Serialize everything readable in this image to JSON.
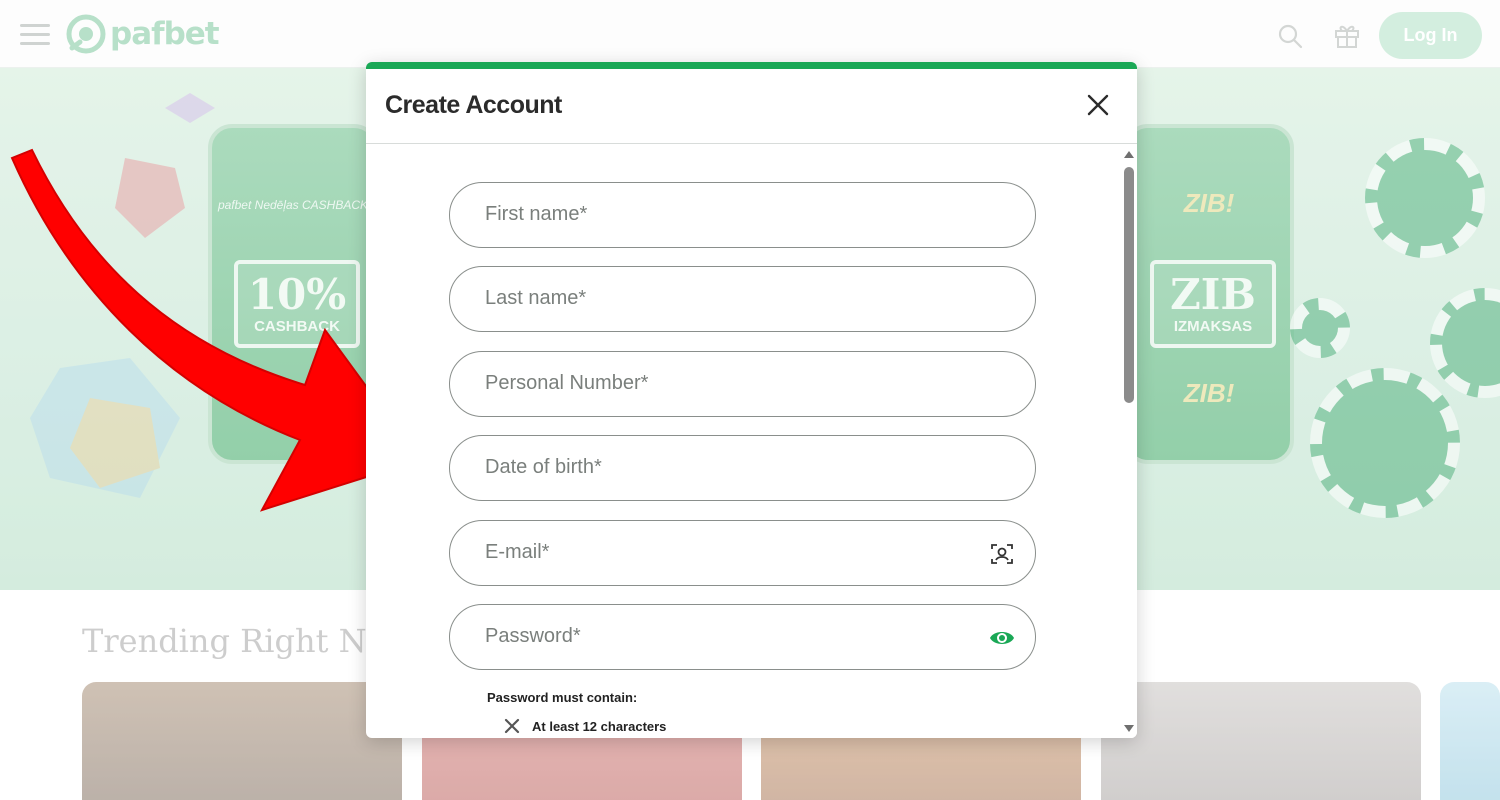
{
  "site": {
    "brand": "pafbet",
    "login_label": "Log In"
  },
  "hero": {
    "left_phone": {
      "brand": "pafbet Nedēļas CASHBACK",
      "badge_big": "10%",
      "badge_small": "CASHBACK"
    },
    "right_phone": {
      "top_text": "ZIB!",
      "badge_big": "ZIB",
      "badge_small": "IZMAKSAS",
      "bottom_text": "ZIB!"
    }
  },
  "trending": {
    "title": "Trending Right Now"
  },
  "modal": {
    "title": "Create Account",
    "fields": [
      {
        "label": "First name",
        "required": "*"
      },
      {
        "label": "Last name",
        "required": "*"
      },
      {
        "label": "Personal Number",
        "required": "*"
      },
      {
        "label": "Date of birth",
        "required": "*"
      },
      {
        "label": "E-mail",
        "required": "*",
        "icon": "contact-autofill-icon"
      },
      {
        "label": "Password",
        "required": "*",
        "icon": "eye-icon"
      }
    ],
    "password_hint": "Password must contain:",
    "password_rules": [
      {
        "text": "At least 12 characters",
        "status": "unmet"
      }
    ]
  },
  "colors": {
    "accent_green": "#1aa856",
    "login_bg": "#c5e9d4",
    "annotation_arrow": "#ff0000"
  }
}
